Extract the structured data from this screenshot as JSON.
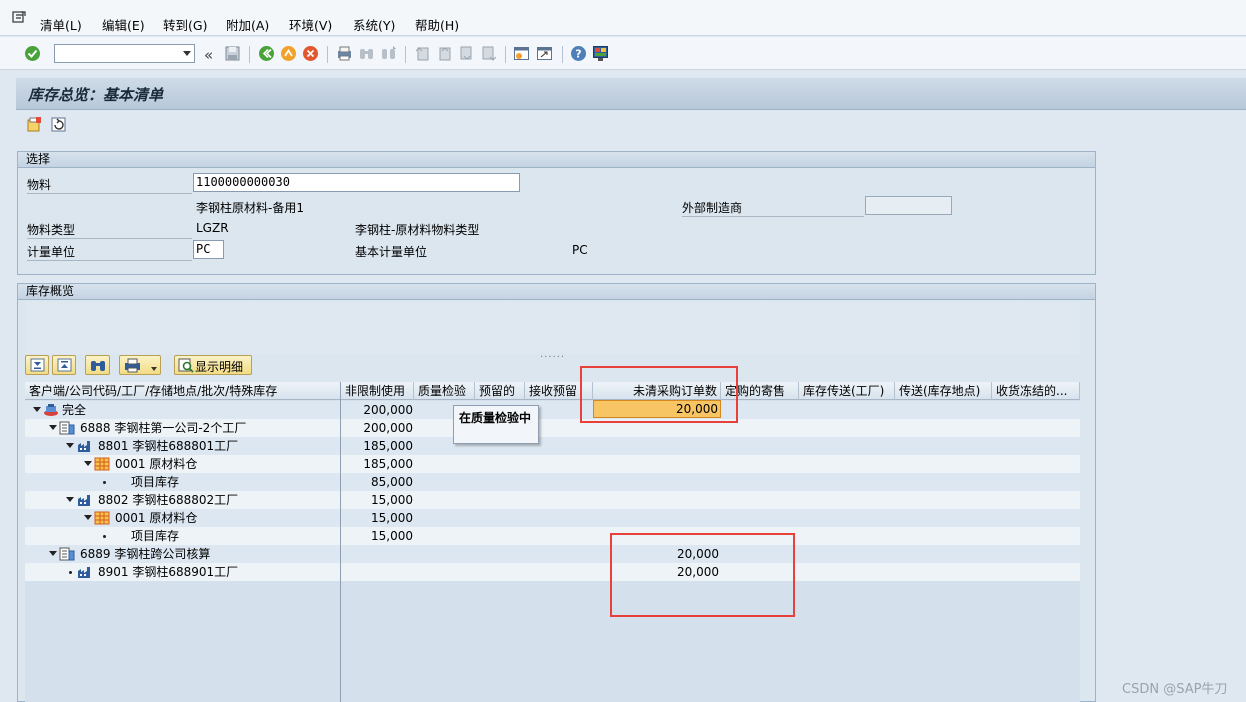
{
  "menu": {
    "items": [
      "清单(L)",
      "编辑(E)",
      "转到(G)",
      "附加(A)",
      "环境(V)",
      "系统(Y)",
      "帮助(H)"
    ]
  },
  "toolbar": {
    "command_value": "",
    "prev_symbol": "«"
  },
  "page": {
    "title": "库存总览：基本清单"
  },
  "selection": {
    "header": "选择",
    "material_label": "物料",
    "material_value": "1100000000030",
    "material_desc": "李钢柱原材料-备用1",
    "external_maker_label": "外部制造商",
    "external_maker_value": "",
    "material_type_label": "物料类型",
    "material_type_value": "LGZR",
    "material_type_desc": "李钢柱-原材料物料类型",
    "uom_label": "计量单位",
    "uom_value": "PC",
    "base_uom_label": "基本计量单位",
    "base_uom_value": "PC"
  },
  "overview": {
    "header": "库存概览",
    "splitter": "......",
    "show_detail_label": "显示明细",
    "columns": [
      "客户端/公司代码/工厂/存储地点/批次/特殊库存",
      "非限制使用",
      "质量检验",
      "预留的",
      "接收预留",
      "未清采购订单数",
      "定购的寄售",
      "库存传送(工厂)",
      "传送(库存地点)",
      "收货冻结的..."
    ],
    "rows": [
      {
        "label": "完全",
        "unrestricted": "200,000",
        "open_po": "20,000"
      },
      {
        "label": "6888 李钢柱第一公司-2个工厂",
        "unrestricted": "200,000",
        "open_po": ""
      },
      {
        "label": "8801 李钢柱688801工厂",
        "unrestricted": "185,000",
        "open_po": ""
      },
      {
        "label": "0001 原材料仓",
        "unrestricted": "185,000",
        "open_po": ""
      },
      {
        "label": "项目库存",
        "unrestricted": "85,000",
        "open_po": ""
      },
      {
        "label": "8802 李钢柱688802工厂",
        "unrestricted": "15,000",
        "open_po": ""
      },
      {
        "label": "0001 原材料仓",
        "unrestricted": "15,000",
        "open_po": ""
      },
      {
        "label": "项目库存",
        "unrestricted": "15,000",
        "open_po": ""
      },
      {
        "label": "6889 李钢柱跨公司核算",
        "unrestricted": "",
        "open_po": "20,000"
      },
      {
        "label": "8901 李钢柱688901工厂",
        "unrestricted": "",
        "open_po": "20,000"
      }
    ],
    "tooltip": "在质量检验中"
  },
  "watermark": "CSDN @SAP牛刀",
  "colors": {
    "highlight_cell": "#f8c565",
    "annotation_red": "#e8413c"
  }
}
